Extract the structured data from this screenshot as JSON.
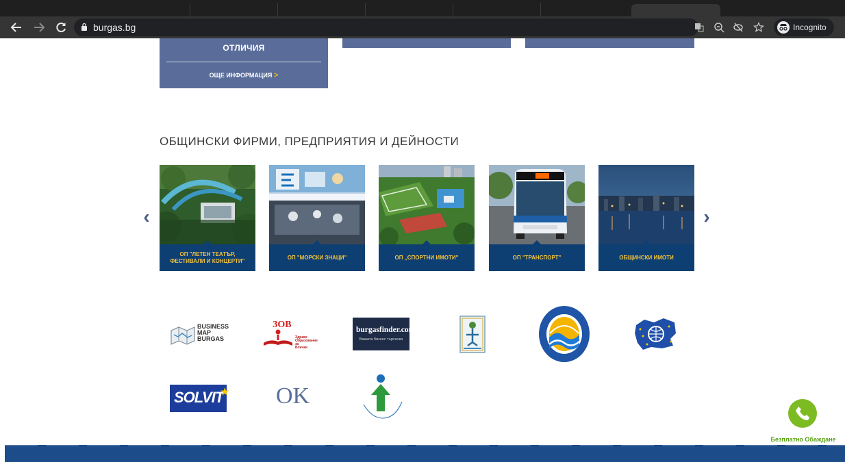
{
  "browser": {
    "url": "burgas.bg",
    "incognito_label": "Incognito",
    "icons": [
      "back-arrow-icon",
      "forward-arrow-icon",
      "reload-icon",
      "lock-icon",
      "translate-icon",
      "zoom-icon",
      "eye-slash-icon",
      "star-icon",
      "incognito-icon"
    ]
  },
  "info_boxes": {
    "first": {
      "heading": "ОТЛИЧИЯ",
      "more_label": "ОЩЕ ИНФОРМАЦИЯ",
      "more_chevron": ">"
    }
  },
  "section": {
    "title": "ОБЩИНСКИ ФИРМИ, ПРЕДПРИЯТИЯ И ДЕЙНОСТИ",
    "prev_arrow": "‹",
    "next_arrow": "›",
    "cards": [
      {
        "caption": "ОП \"ЛЕТЕН ТЕАТЪР, ФЕСТИВАЛИ И КОНЦЕРТИ\""
      },
      {
        "caption": "ОП \"МОРСКИ ЗНАЦИ\""
      },
      {
        "caption": "ОП „СПОРТНИ ИМОТИ\""
      },
      {
        "caption": "ОП \"ТРАНСПОРТ\""
      },
      {
        "caption": "ОБЩИНСКИ ИМОТИ"
      }
    ]
  },
  "partners": {
    "business_map": {
      "line1": "BUSINESS",
      "line2": "MAP",
      "line3": "BURGAS"
    },
    "zov": {
      "title": "ЗОВ",
      "subtitle_1": "Здраве",
      "subtitle_2": "Образование за",
      "subtitle_3": "Всички"
    },
    "burgasfinder": {
      "name": "burgasfinder.com",
      "tagline": "Вашата бизнес търсачка"
    },
    "fund_logo": "obshtestven-daritelski-fond-logo",
    "solvit": {
      "name": "SOLVIT",
      "star": "★"
    },
    "ok": {
      "name": "OK"
    },
    "slogan_logo": "litse-kam-horata-logo",
    "emblem_logo": "municipal-emblem-logo",
    "eu_map_logo": "eu-bulgaria-map-logo"
  },
  "phone_widget": {
    "label": "Безплатно Обаждане"
  },
  "colors": {
    "chrome_dark": "#353535",
    "info_box": "#5a6d9a",
    "card_caption_bg": "#0d3f73",
    "caption_text": "#f3c23c",
    "phone_green": "#7dbb23",
    "footer_blue": "#1c4c8a"
  }
}
